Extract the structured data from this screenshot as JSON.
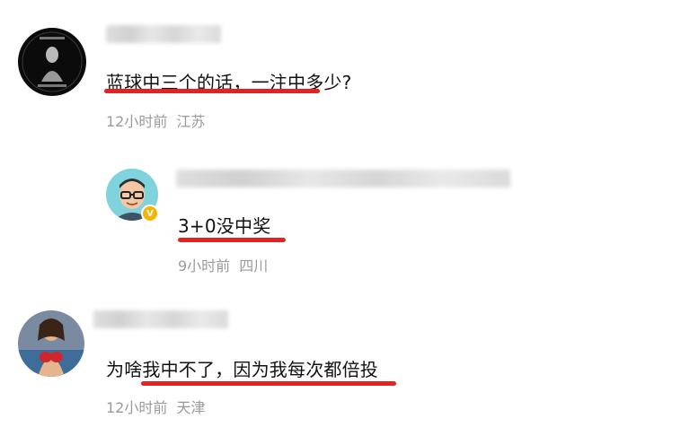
{
  "comments": [
    {
      "text": "蓝球中三个的话，一注中多少?",
      "time": "12小时前",
      "location": "江苏"
    },
    {
      "text": "3+0没中奖",
      "time": "9小时前",
      "location": "四川"
    },
    {
      "text": "为啥我中不了，因为我每次都倍投",
      "time": "12小时前",
      "location": "天津"
    }
  ],
  "colors": {
    "underline": "#e32222",
    "meta": "#9a9a9a",
    "verified_badge": "#f5b400"
  },
  "icons": {
    "verified": "verified-badge-icon"
  }
}
